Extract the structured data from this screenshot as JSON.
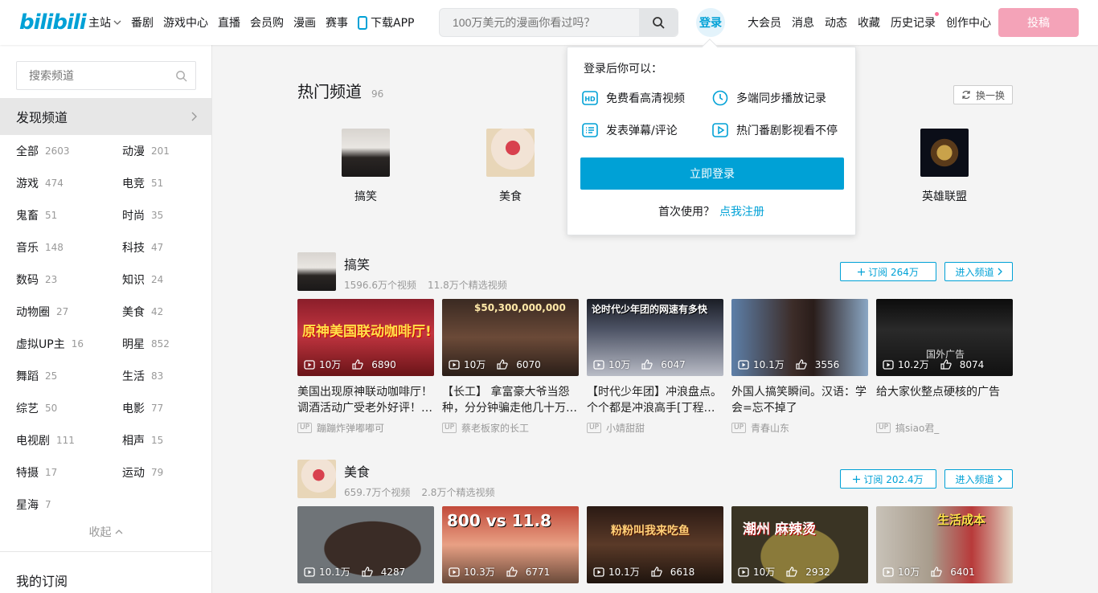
{
  "header": {
    "logo_text": "bilibili",
    "nav_left": [
      "主站",
      "番剧",
      "游戏中心",
      "直播",
      "会员购",
      "漫画",
      "赛事"
    ],
    "download_app": "下载APP",
    "search_placeholder": "100万美元的漫画你看过吗？",
    "login": "登录",
    "nav_right": [
      "大会员",
      "消息",
      "动态",
      "收藏",
      "历史记录",
      "创作中心"
    ],
    "upload": "投稿",
    "accent": "#00a1d6",
    "pink": "#f4a3b8"
  },
  "sidebar": {
    "search_placeholder": "搜索频道",
    "discover": "发现频道",
    "categories": [
      {
        "name": "全部",
        "count": "2603"
      },
      {
        "name": "动漫",
        "count": "201"
      },
      {
        "name": "游戏",
        "count": "474"
      },
      {
        "name": "电竞",
        "count": "51"
      },
      {
        "name": "鬼畜",
        "count": "51"
      },
      {
        "name": "时尚",
        "count": "35"
      },
      {
        "name": "音乐",
        "count": "148"
      },
      {
        "name": "科技",
        "count": "47"
      },
      {
        "name": "数码",
        "count": "23"
      },
      {
        "name": "知识",
        "count": "24"
      },
      {
        "name": "动物圈",
        "count": "27"
      },
      {
        "name": "美食",
        "count": "42"
      },
      {
        "name": "虚拟UP主",
        "count": "16"
      },
      {
        "name": "明星",
        "count": "852"
      },
      {
        "name": "舞蹈",
        "count": "25"
      },
      {
        "name": "生活",
        "count": "83"
      },
      {
        "name": "综艺",
        "count": "50"
      },
      {
        "name": "电影",
        "count": "77"
      },
      {
        "name": "电视剧",
        "count": "111"
      },
      {
        "name": "相声",
        "count": "15"
      },
      {
        "name": "特摄",
        "count": "17"
      },
      {
        "name": "运动",
        "count": "79"
      },
      {
        "name": "星海",
        "count": "7"
      }
    ],
    "collapse": "收起",
    "my_subscriptions": "我的订阅"
  },
  "hot": {
    "title": "热门频道",
    "count": "96",
    "refresh": "换一换",
    "channels": [
      {
        "name": "搞笑"
      },
      {
        "name": "美食"
      },
      {
        "name": "英雄联盟"
      }
    ]
  },
  "popup": {
    "heading": "登录后你可以：",
    "features": [
      "免费看高清视频",
      "多端同步播放记录",
      "发表弹幕/评论",
      "热门番剧影视看不停"
    ],
    "login_button": "立即登录",
    "first_use": "首次使用？",
    "register": "点我注册"
  },
  "sections": [
    {
      "name": "搞笑",
      "videos_count": "1596.6万个视频",
      "featured_count": "11.8万个精选视频",
      "subscribe": "订阅 264万",
      "enter": "进入频道",
      "videos": [
        {
          "views": "10万",
          "likes": "6890",
          "title": "美国出现原神联动咖啡厅！调酒活动广受老外好评！…",
          "up": "蹦蹦炸弹嘟嘟可",
          "overlay": "原神美国联动咖啡厅!"
        },
        {
          "views": "10万",
          "likes": "6070",
          "title": "【长工】 拿富豪大爷当怨种，分分钟骗走他几十万…",
          "up": "蔡老板家的长工",
          "overlay": "$50,300,000,000"
        },
        {
          "views": "10万",
          "likes": "6047",
          "title": "【时代少年团】冲浪盘点。个个都是冲浪高手[丁程…",
          "up": "小婧甜甜",
          "overlay": "论时代少年团的网速有多快"
        },
        {
          "views": "10.1万",
          "likes": "3556",
          "title": "外国人搞笑瞬间。汉语：学会=忘不掉了",
          "up": "青春山东",
          "overlay": ""
        },
        {
          "views": "10.2万",
          "likes": "8074",
          "title": "给大家伙整点硬核的广告",
          "up": "搞siao君_",
          "overlay": "国外广告"
        }
      ]
    },
    {
      "name": "美食",
      "videos_count": "659.7万个视频",
      "featured_count": "2.8万个精选视频",
      "subscribe": "订阅 202.4万",
      "enter": "进入频道",
      "videos": [
        {
          "views": "10.1万",
          "likes": "4287",
          "overlay": ""
        },
        {
          "views": "10.3万",
          "likes": "6771",
          "overlay": "800 vs 11.8"
        },
        {
          "views": "10.1万",
          "likes": "6618",
          "overlay": "粉粉叫我来吃鱼"
        },
        {
          "views": "10万",
          "likes": "2932",
          "overlay": "潮州 麻辣烫"
        },
        {
          "views": "10万",
          "likes": "6401",
          "overlay": "生活成本"
        }
      ]
    }
  ]
}
